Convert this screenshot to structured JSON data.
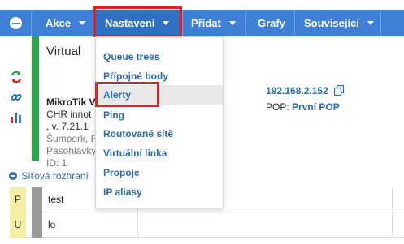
{
  "nav": {
    "items": [
      {
        "label": "Akce"
      },
      {
        "label": "Nastavení"
      },
      {
        "label": "Přidat"
      },
      {
        "label": "Grafy"
      },
      {
        "label": "Související"
      }
    ]
  },
  "device": {
    "title": "Virtual",
    "model": "MikroTik V",
    "line2": "CHR innot",
    "line3": ", v. 7.21.1",
    "line4": "Šumperk, F",
    "line5": "Pasohlávky",
    "line6": "ID: 1"
  },
  "ip": "192.168.2.152",
  "pop": {
    "prefix": "POP:",
    "link": "První POP"
  },
  "section_title": "Síťová rozhraní",
  "interfaces": [
    {
      "badge": "P",
      "name": "test"
    },
    {
      "badge": "U",
      "name": "lo"
    }
  ],
  "dropdown": {
    "items": [
      {
        "label": "Queue trees"
      },
      {
        "label": "Přípojné body"
      },
      {
        "label": "Alerty"
      },
      {
        "label": "Ping"
      },
      {
        "label": "Routované sítě"
      },
      {
        "label": "Virtuální linka"
      },
      {
        "label": "Propoje"
      },
      {
        "label": "IP aliasy"
      }
    ]
  },
  "colors": {
    "navbar": "#3d80d5",
    "accent_link": "#2a6ab0",
    "status_green": "#27a844",
    "highlight_red": "#e02020",
    "badge_yellow": "#f3efa3"
  }
}
